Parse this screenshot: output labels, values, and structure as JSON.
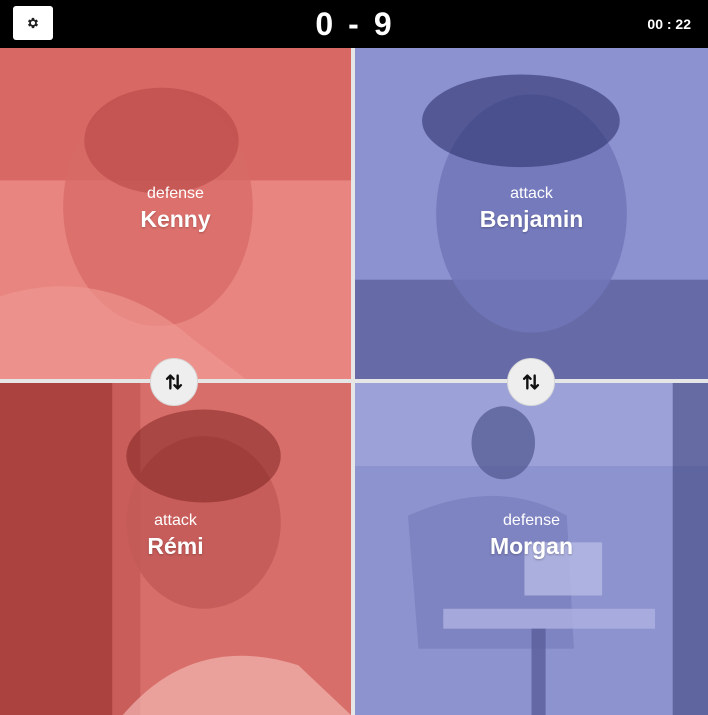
{
  "header": {
    "settings_icon": "gear-icon",
    "score_red": "0",
    "score_separator": "-",
    "score_blue": "9",
    "timer": "00 : 22"
  },
  "colors": {
    "red_team": "#e07a76",
    "blue_team": "#7f86c4",
    "topbar": "#000000"
  },
  "players": {
    "red_defense": {
      "role": "defense",
      "name": "Kenny"
    },
    "blue_attack": {
      "role": "attack",
      "name": "Benjamin"
    },
    "red_attack": {
      "role": "attack",
      "name": "Rémi"
    },
    "blue_defense": {
      "role": "defense",
      "name": "Morgan"
    }
  },
  "swap_buttons": {
    "red_icon": "swap-vertical-icon",
    "blue_icon": "swap-vertical-icon"
  }
}
